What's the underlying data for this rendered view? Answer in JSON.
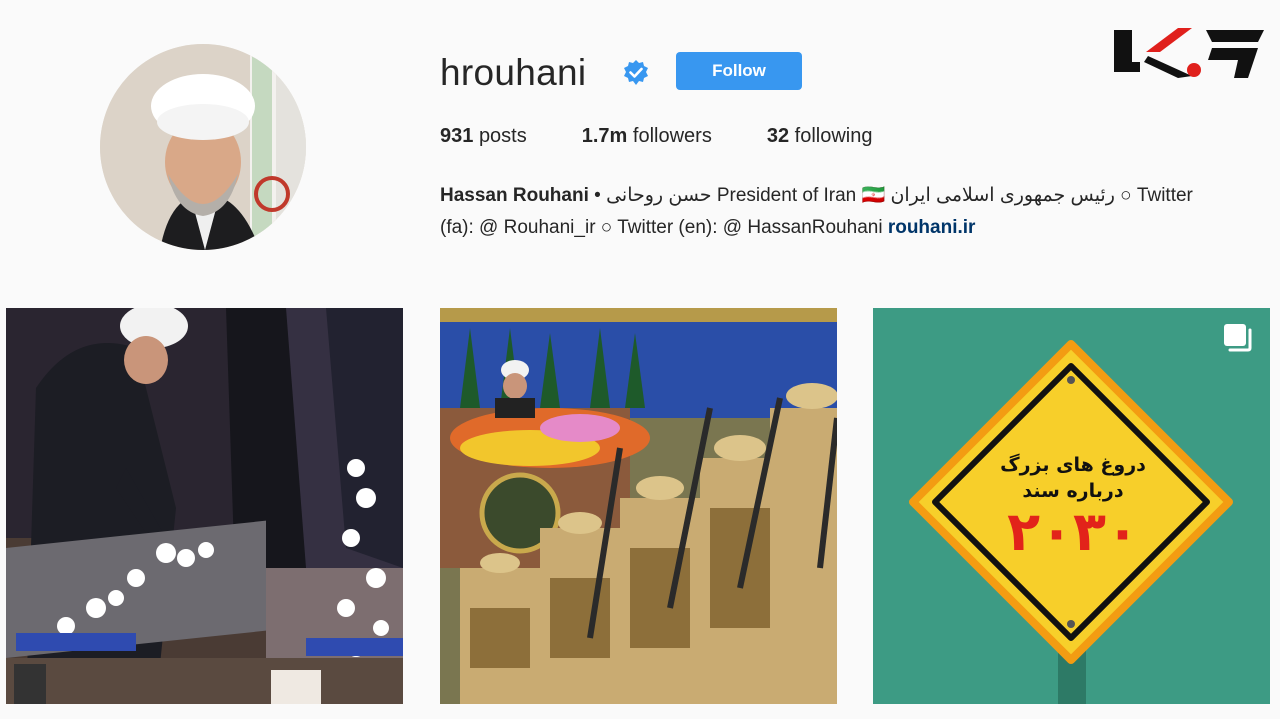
{
  "profile": {
    "username": "hrouhani",
    "follow_label": "Follow",
    "verified_icon": "verified-badge-icon",
    "stats": {
      "posts_count": "931",
      "posts_label": "posts",
      "followers_count": "1.7m",
      "followers_label": "followers",
      "following_count": "32",
      "following_label": "following"
    },
    "bio": {
      "full_name": "Hassan Rouhani",
      "line1_rest": " • حسن روحانی President of Iran 🇮🇷 رئیس جمهوری اسلامی ایران ○ Twitter",
      "line2": "(fa): @ Rouhani_ir ○ Twitter (en): @ HassanRouhani ",
      "link": "rouhani.ir"
    }
  },
  "posts": [
    {
      "icon": "photo-icon"
    },
    {
      "icon": "photo-icon"
    },
    {
      "icon": "multi-post-icon",
      "sign_line1": "دروغ های بزرگ",
      "sign_line2": "درباره سند",
      "sign_number": "۲۰۳۰"
    }
  ],
  "colors": {
    "follow_button": "#3897f0",
    "verified": "#3897f0",
    "link": "#003569",
    "sign_yellow": "#f7cf2a",
    "sign_red": "#e2231a",
    "tile_green": "#3d9b84",
    "logo_red": "#e0201c"
  }
}
